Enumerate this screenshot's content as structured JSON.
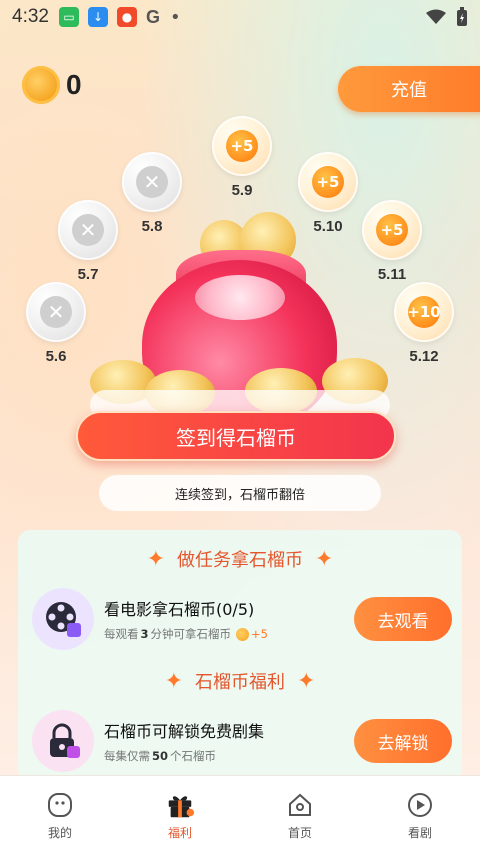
{
  "status": {
    "time": "4:32",
    "g_icon": "G",
    "dot": "•"
  },
  "coins": {
    "count": "0"
  },
  "recharge_label": "充值",
  "days": [
    {
      "label": "5.6",
      "state": "missed",
      "mark": "✕"
    },
    {
      "label": "5.7",
      "state": "missed",
      "mark": "✕"
    },
    {
      "label": "5.8",
      "state": "missed",
      "mark": "✕"
    },
    {
      "label": "5.9",
      "state": "reward",
      "mark": "+5"
    },
    {
      "label": "5.10",
      "state": "reward",
      "mark": "+5"
    },
    {
      "label": "5.11",
      "state": "reward",
      "mark": "+5"
    },
    {
      "label": "5.12",
      "state": "reward",
      "mark": "+10"
    }
  ],
  "sign_button": "签到得石榴币",
  "streak_text": "连续签到，石榴币翻倍",
  "tasks_section": {
    "title": "做任务拿石榴币",
    "task": {
      "title": "看电影拿石榴币(0/5)",
      "sub_prefix": "每观看",
      "sub_num": "3",
      "sub_mid": "分钟可拿石榴币",
      "sub_reward": "+5",
      "button": "去观看"
    }
  },
  "benefit_section": {
    "title": "石榴币福利",
    "task": {
      "title": "石榴币可解锁免费剧集",
      "sub_prefix": "每集仅需",
      "sub_num": "50",
      "sub_suffix": "个石榴币",
      "button": "去解锁"
    }
  },
  "nav": [
    {
      "label": "我的",
      "icon": "face-icon",
      "active": false
    },
    {
      "label": "福利",
      "icon": "gift-icon",
      "active": true
    },
    {
      "label": "首页",
      "icon": "home-icon",
      "active": false
    },
    {
      "label": "看剧",
      "icon": "play-icon",
      "active": false
    }
  ],
  "colors": {
    "accent": "#ff7a2a",
    "sign_button": "#f3344d",
    "section_title": "#e4572e"
  }
}
